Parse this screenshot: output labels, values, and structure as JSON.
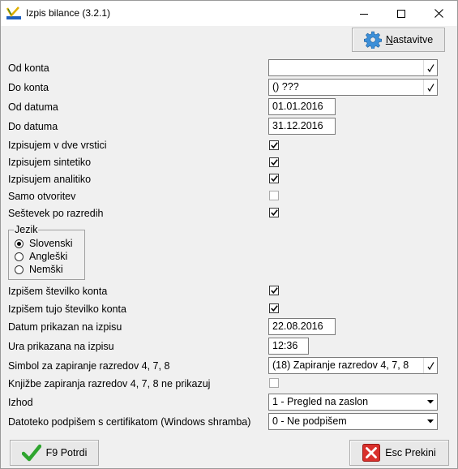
{
  "window": {
    "title": "Izpis bilance  (3.2.1)"
  },
  "toolbar": {
    "settings_label_accel": "N",
    "settings_label_rest": "astavitve"
  },
  "form": {
    "od_konta": {
      "label": "Od konta",
      "value": ""
    },
    "do_konta": {
      "label": "Do konta",
      "value": "() ???"
    },
    "od_datuma": {
      "label": "Od datuma",
      "value": "01.01.2016"
    },
    "do_datuma": {
      "label": "Do datuma",
      "value": "31.12.2016"
    },
    "dve_vrstici": {
      "label": "Izpisujem v dve vrstici",
      "checked": true
    },
    "sintetiko": {
      "label": "Izpisujem sintetiko",
      "checked": true
    },
    "analitiko": {
      "label": "Izpisujem analitiko",
      "checked": true
    },
    "samo_otvoritev": {
      "label": "Samo otvoritev",
      "checked": false
    },
    "sestevek": {
      "label": "Seštevek po razredih",
      "checked": true
    },
    "jezik": {
      "title": "Jezik",
      "options": [
        "Slovenski",
        "Angleški",
        "Nemški"
      ],
      "selected": "Slovenski"
    },
    "stevilko_konta": {
      "label": "Izpišem številko konta",
      "checked": true
    },
    "tujo_stevilko": {
      "label": "Izpišem tujo številko konta",
      "checked": true
    },
    "datum_prikazan": {
      "label": "Datum prikazan na izpisu",
      "value": "22.08.2016"
    },
    "ura_prikazana": {
      "label": "Ura prikazana na izpisu",
      "value": "12:36"
    },
    "simbol": {
      "label": "Simbol za zapiranje razredov 4, 7, 8",
      "value": "(18) Zapiranje razredov 4, 7, 8"
    },
    "knjizbe": {
      "label": "Knjižbe zapiranja razredov 4, 7, 8 ne prikazuj",
      "checked": false
    },
    "izhod": {
      "label": "Izhod",
      "value": "1 - Pregled na zaslon"
    },
    "podpisem": {
      "label": "Datoteko podpišem s certifikatom (Windows shramba)",
      "value": "0 - Ne podpišem"
    }
  },
  "footer": {
    "confirm_label": "F9 Potrdi",
    "cancel_label": "Esc Prekini"
  },
  "colors": {
    "confirm_check": "#2fa52f",
    "cancel_x": "#d9302c",
    "gear": "#3c8fd8"
  }
}
